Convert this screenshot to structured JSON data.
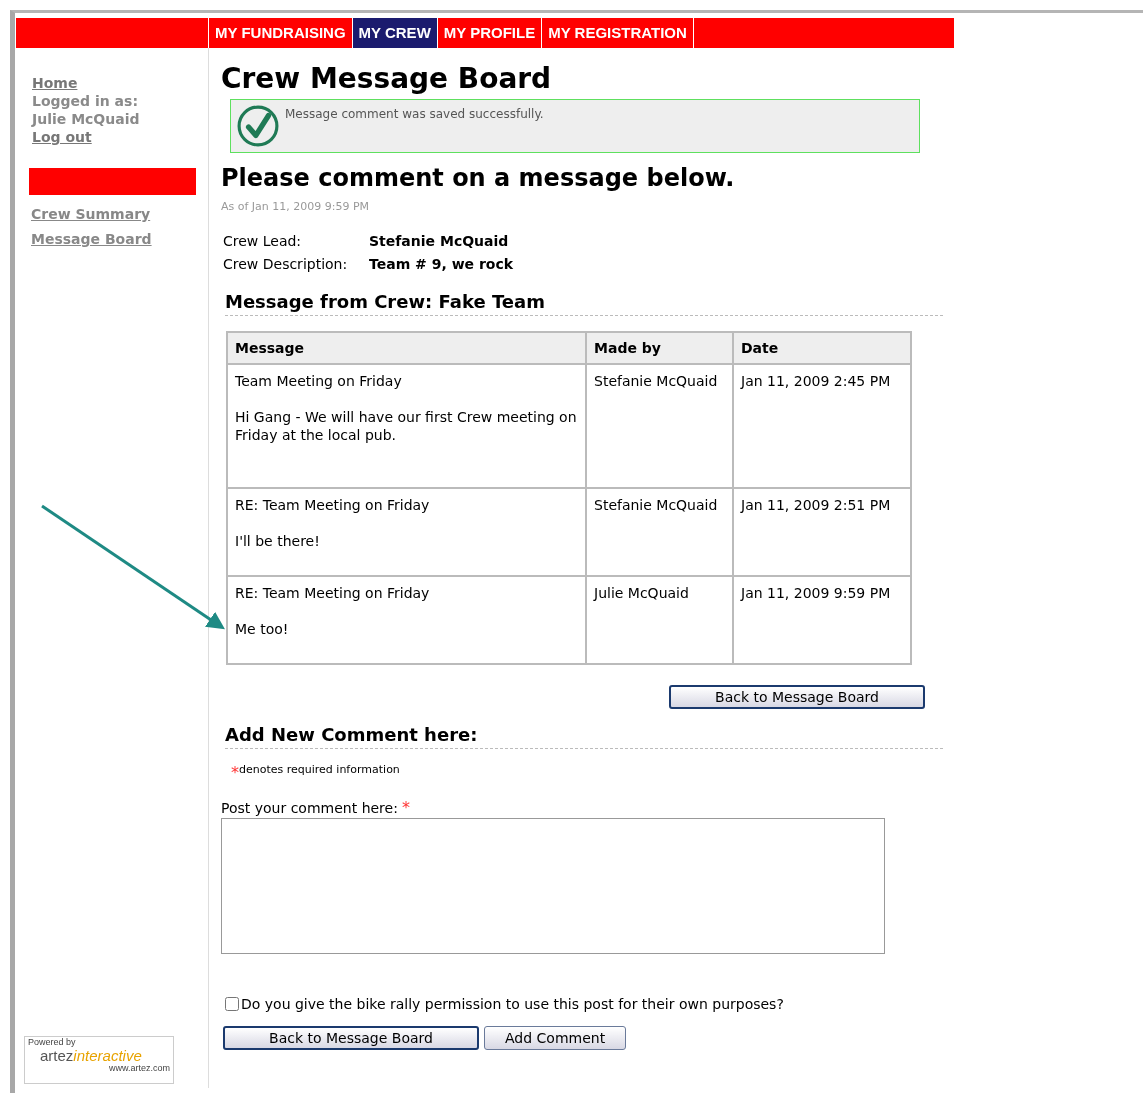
{
  "tabs": [
    {
      "label": "MY FUNDRAISING",
      "selected": false
    },
    {
      "label": "MY CREW",
      "selected": true
    },
    {
      "label": "MY PROFILE",
      "selected": false
    },
    {
      "label": "MY REGISTRATION",
      "selected": false
    }
  ],
  "sidebar": {
    "home": "Home",
    "logged_in_label": "Logged in as:",
    "user": "Julie McQuaid",
    "logout": "Log out",
    "items": [
      "Crew Summary",
      "Message Board"
    ],
    "logo": {
      "powered_by": "Powered by",
      "brand_a": "artez",
      "brand_b": "interactive",
      "url": "www.artez.com"
    }
  },
  "title": "Crew Message Board",
  "notice": "Message comment was saved successfully.",
  "subtitle": "Please comment on a message below.",
  "as_of": "As of Jan 11, 2009 9:59 PM",
  "details": [
    {
      "label": "Crew Lead:",
      "value": "Stefanie McQuaid"
    },
    {
      "label": "Crew Description:",
      "value": "Team # 9, we rock"
    }
  ],
  "message_heading": "Message from Crew: Fake Team",
  "table": {
    "columns": [
      "Message",
      "Made by",
      "Date"
    ],
    "rows": [
      {
        "subject": "Team Meeting on Friday",
        "body": "Hi Gang -  We will have our first Crew meeting on Friday at the local pub.",
        "made_by": "Stefanie McQuaid",
        "date": "Jan 11, 2009 2:45 PM"
      },
      {
        "subject": "RE: Team Meeting on Friday",
        "body": "I'll be there!",
        "made_by": "Stefanie McQuaid",
        "date": "Jan 11, 2009 2:51 PM"
      },
      {
        "subject": "RE: Team Meeting on Friday",
        "body": "Me too!",
        "made_by": "Julie McQuaid",
        "date": "Jan 11, 2009 9:59 PM"
      }
    ]
  },
  "back_button_top": "Back to Message Board",
  "comment_heading": "Add New Comment here:",
  "required_mark": "*",
  "required_note": "denotes required information",
  "comment_label": "Post your comment here:",
  "comment_required_mark": "*",
  "permission": {
    "label": "Do you give the bike rally permission to use this post for their own purposes?",
    "checked": false
  },
  "buttons": [
    "Back to Message Board",
    "Add Comment"
  ]
}
